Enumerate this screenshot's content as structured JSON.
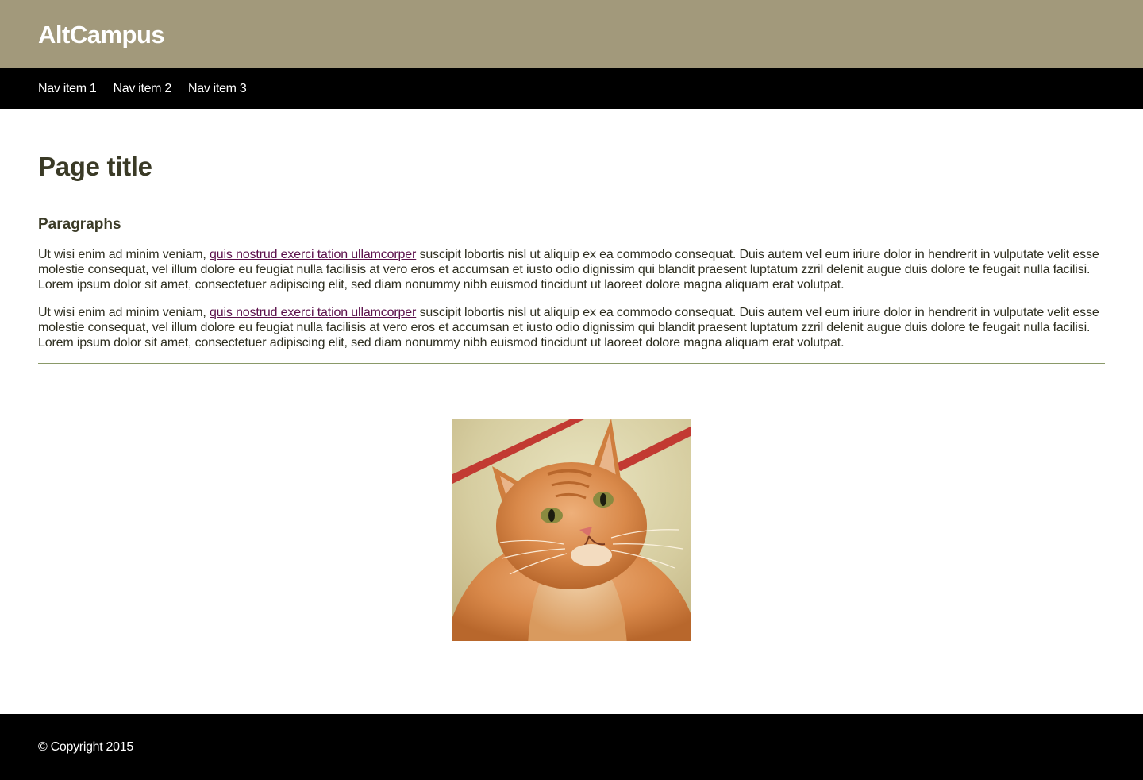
{
  "header": {
    "logo_text": "AltCampus"
  },
  "nav": {
    "items": [
      {
        "label": "Nav item 1"
      },
      {
        "label": "Nav item 2"
      },
      {
        "label": "Nav item 3"
      }
    ]
  },
  "main": {
    "page_title": "Page title",
    "section_heading": "Paragraphs",
    "paragraphs": [
      {
        "before": "Ut wisi enim ad minim veniam, ",
        "link": "quis nostrud exerci tation ullamcorper",
        "after": " suscipit lobortis nisl ut aliquip ex ea commodo consequat. Duis autem vel eum iriure dolor in hendrerit in vulputate velit esse molestie consequat, vel illum dolore eu feugiat nulla facilisis at vero eros et accumsan et iusto odio dignissim qui blandit praesent luptatum zzril delenit augue duis dolore te feugait nulla facilisi. Lorem ipsum dolor sit amet, consectetuer adipiscing elit, sed diam nonummy nibh euismod tincidunt ut laoreet dolore magna aliquam erat volutpat."
      },
      {
        "before": "Ut wisi enim ad minim veniam, ",
        "link": "quis nostrud exerci tation ullamcorper",
        "after": " suscipit lobortis nisl ut aliquip ex ea commodo consequat. Duis autem vel eum iriure dolor in hendrerit in vulputate velit esse molestie consequat, vel illum dolore eu feugiat nulla facilisis at vero eros et accumsan et iusto odio dignissim qui blandit praesent luptatum zzril delenit augue duis dolore te feugait nulla facilisi. Lorem ipsum dolor sit amet, consectetuer adipiscing elit, sed diam nonummy nibh euismod tincidunt ut laoreet dolore magna aliquam erat volutpat."
      }
    ],
    "image": {
      "subject": "orange tabby cat photo"
    }
  },
  "footer": {
    "copyright": "© Copyright 2015"
  },
  "colors": {
    "header_bg": "#a2997b",
    "nav_bg": "#000000",
    "footer_bg": "#000000",
    "heading_text": "#3a3a26",
    "rule": "#8a9968",
    "link": "#5a0f4a"
  }
}
